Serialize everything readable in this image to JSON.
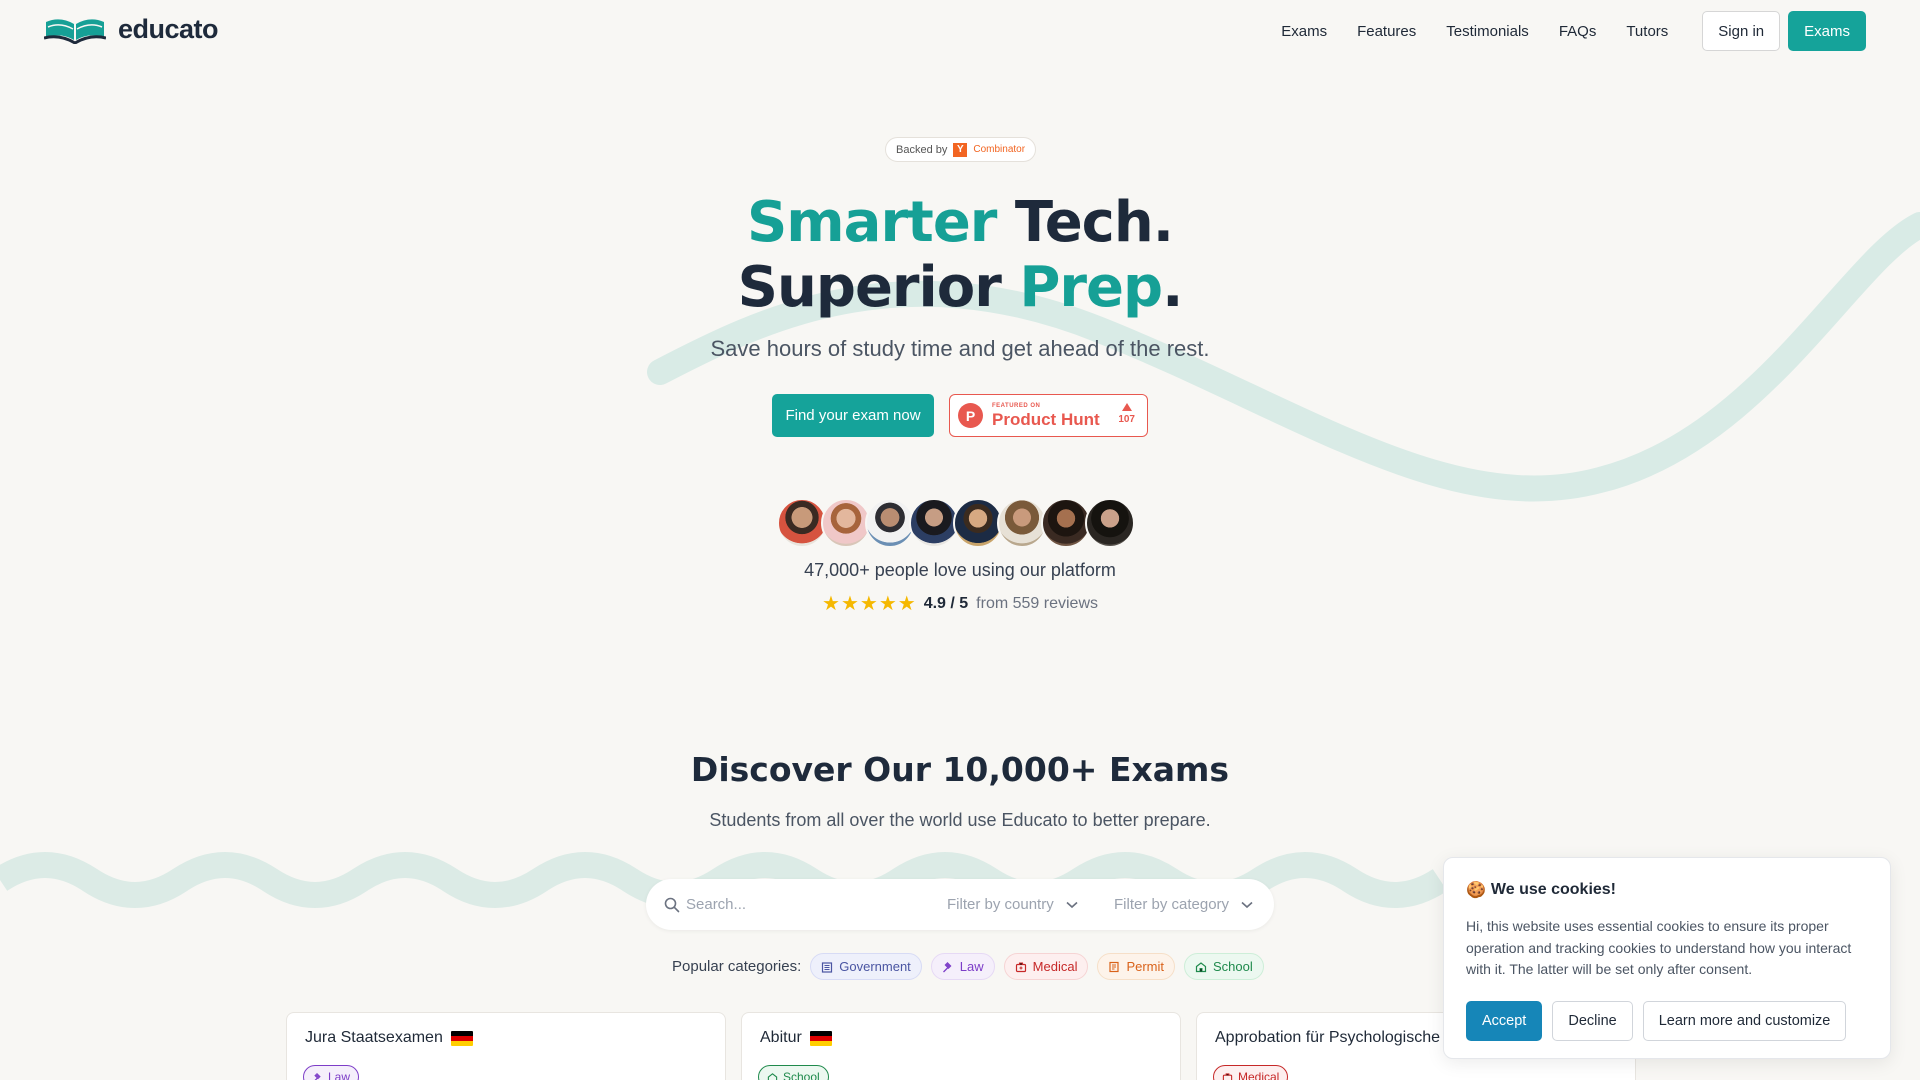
{
  "brand": {
    "name": "educato"
  },
  "nav": {
    "links": [
      "Exams",
      "Features",
      "Testimonials",
      "FAQs",
      "Tutors"
    ],
    "signin": "Sign in",
    "exams_button": "Exams"
  },
  "hero": {
    "backed_by": "Backed by",
    "yc_letter": "Y",
    "yc_name": "Combinator",
    "headline_1a": "Smarter",
    "headline_1b": " Tech.",
    "headline_2a": "Superior ",
    "headline_2b": "Prep",
    "headline_2c": ".",
    "subhead": "Save hours of study time and get ahead of the rest.",
    "cta": "Find your exam now",
    "product_hunt": {
      "letter": "P",
      "featured": "FEATURED ON",
      "name": "Product Hunt",
      "votes": "107"
    },
    "users_text": "47,000+ people love using our platform",
    "rating": {
      "stars": 5,
      "value": "4.9 / 5",
      "from": "from 559 reviews"
    }
  },
  "discover": {
    "title": "Discover Our 10,000+ Exams",
    "subtitle": "Students from all over the world use Educato to better prepare.",
    "search_placeholder": "Search...",
    "filter_country": "Filter by country",
    "filter_category": "Filter by category",
    "popular_label": "Popular categories:",
    "categories": [
      "Government",
      "Law",
      "Medical",
      "Permit",
      "School"
    ]
  },
  "cards": [
    {
      "title": "Jura Staatsexamen",
      "tag": "Law"
    },
    {
      "title": "Abitur",
      "tag": "School"
    },
    {
      "title": "Approbation für Psychologische",
      "tag": "Medical"
    }
  ],
  "cookie": {
    "emoji": "🍪",
    "title": "We use cookies!",
    "text": "Hi, this website uses essential cookies to ensure its proper operation and tracking cookies to understand how you interact with it. The latter will be set only after consent.",
    "accept": "Accept",
    "decline": "Decline",
    "learn_more": "Learn more and customize"
  },
  "colors": {
    "brand_teal": "#15a39a",
    "accept_blue": "#1686b8",
    "product_hunt_red": "#e8584f",
    "star_yellow": "#f5b800"
  }
}
